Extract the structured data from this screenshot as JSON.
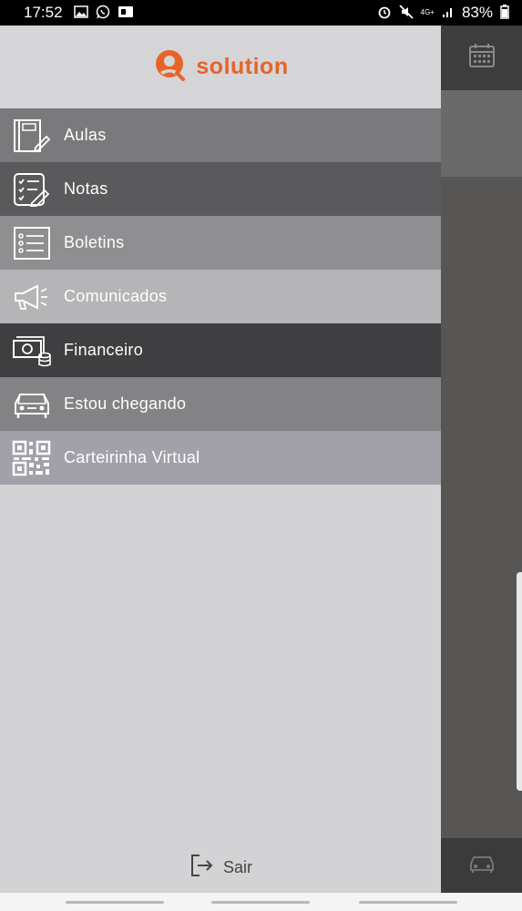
{
  "status_bar": {
    "time": "17:52",
    "battery": "83%",
    "network": "4G+"
  },
  "brand": {
    "name": "solution",
    "color": "#e8632a"
  },
  "menu": [
    {
      "label": "Aulas",
      "icon": "notebook-icon",
      "bg": "#7a797b"
    },
    {
      "label": "Notas",
      "icon": "checklist-edit-icon",
      "bg": "#5a595b"
    },
    {
      "label": "Boletins",
      "icon": "list-icon",
      "bg": "#8f8e90"
    },
    {
      "label": "Comunicados",
      "icon": "megaphone-icon",
      "bg": "#b5b4b6"
    },
    {
      "label": "Financeiro",
      "icon": "money-icon",
      "bg": "#3f3e40"
    },
    {
      "label": "Estou chegando",
      "icon": "car-icon",
      "bg": "#838284"
    },
    {
      "label": "Carteirinha Virtual",
      "icon": "qr-code-icon",
      "bg": "#a2a1a9"
    }
  ],
  "footer": {
    "logout_label": "Sair"
  }
}
